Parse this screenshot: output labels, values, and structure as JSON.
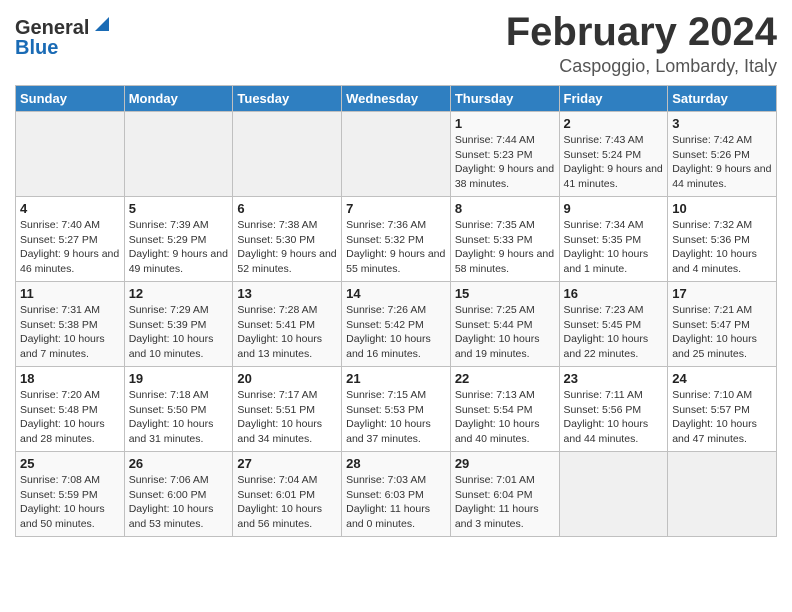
{
  "logo": {
    "text_general": "General",
    "text_blue": "Blue"
  },
  "title": "February 2024",
  "location": "Caspoggio, Lombardy, Italy",
  "weekdays": [
    "Sunday",
    "Monday",
    "Tuesday",
    "Wednesday",
    "Thursday",
    "Friday",
    "Saturday"
  ],
  "weeks": [
    [
      {
        "day": "",
        "sunrise": "",
        "sunset": "",
        "daylight": ""
      },
      {
        "day": "",
        "sunrise": "",
        "sunset": "",
        "daylight": ""
      },
      {
        "day": "",
        "sunrise": "",
        "sunset": "",
        "daylight": ""
      },
      {
        "day": "",
        "sunrise": "",
        "sunset": "",
        "daylight": ""
      },
      {
        "day": "1",
        "sunrise": "Sunrise: 7:44 AM",
        "sunset": "Sunset: 5:23 PM",
        "daylight": "Daylight: 9 hours and 38 minutes."
      },
      {
        "day": "2",
        "sunrise": "Sunrise: 7:43 AM",
        "sunset": "Sunset: 5:24 PM",
        "daylight": "Daylight: 9 hours and 41 minutes."
      },
      {
        "day": "3",
        "sunrise": "Sunrise: 7:42 AM",
        "sunset": "Sunset: 5:26 PM",
        "daylight": "Daylight: 9 hours and 44 minutes."
      }
    ],
    [
      {
        "day": "4",
        "sunrise": "Sunrise: 7:40 AM",
        "sunset": "Sunset: 5:27 PM",
        "daylight": "Daylight: 9 hours and 46 minutes."
      },
      {
        "day": "5",
        "sunrise": "Sunrise: 7:39 AM",
        "sunset": "Sunset: 5:29 PM",
        "daylight": "Daylight: 9 hours and 49 minutes."
      },
      {
        "day": "6",
        "sunrise": "Sunrise: 7:38 AM",
        "sunset": "Sunset: 5:30 PM",
        "daylight": "Daylight: 9 hours and 52 minutes."
      },
      {
        "day": "7",
        "sunrise": "Sunrise: 7:36 AM",
        "sunset": "Sunset: 5:32 PM",
        "daylight": "Daylight: 9 hours and 55 minutes."
      },
      {
        "day": "8",
        "sunrise": "Sunrise: 7:35 AM",
        "sunset": "Sunset: 5:33 PM",
        "daylight": "Daylight: 9 hours and 58 minutes."
      },
      {
        "day": "9",
        "sunrise": "Sunrise: 7:34 AM",
        "sunset": "Sunset: 5:35 PM",
        "daylight": "Daylight: 10 hours and 1 minute."
      },
      {
        "day": "10",
        "sunrise": "Sunrise: 7:32 AM",
        "sunset": "Sunset: 5:36 PM",
        "daylight": "Daylight: 10 hours and 4 minutes."
      }
    ],
    [
      {
        "day": "11",
        "sunrise": "Sunrise: 7:31 AM",
        "sunset": "Sunset: 5:38 PM",
        "daylight": "Daylight: 10 hours and 7 minutes."
      },
      {
        "day": "12",
        "sunrise": "Sunrise: 7:29 AM",
        "sunset": "Sunset: 5:39 PM",
        "daylight": "Daylight: 10 hours and 10 minutes."
      },
      {
        "day": "13",
        "sunrise": "Sunrise: 7:28 AM",
        "sunset": "Sunset: 5:41 PM",
        "daylight": "Daylight: 10 hours and 13 minutes."
      },
      {
        "day": "14",
        "sunrise": "Sunrise: 7:26 AM",
        "sunset": "Sunset: 5:42 PM",
        "daylight": "Daylight: 10 hours and 16 minutes."
      },
      {
        "day": "15",
        "sunrise": "Sunrise: 7:25 AM",
        "sunset": "Sunset: 5:44 PM",
        "daylight": "Daylight: 10 hours and 19 minutes."
      },
      {
        "day": "16",
        "sunrise": "Sunrise: 7:23 AM",
        "sunset": "Sunset: 5:45 PM",
        "daylight": "Daylight: 10 hours and 22 minutes."
      },
      {
        "day": "17",
        "sunrise": "Sunrise: 7:21 AM",
        "sunset": "Sunset: 5:47 PM",
        "daylight": "Daylight: 10 hours and 25 minutes."
      }
    ],
    [
      {
        "day": "18",
        "sunrise": "Sunrise: 7:20 AM",
        "sunset": "Sunset: 5:48 PM",
        "daylight": "Daylight: 10 hours and 28 minutes."
      },
      {
        "day": "19",
        "sunrise": "Sunrise: 7:18 AM",
        "sunset": "Sunset: 5:50 PM",
        "daylight": "Daylight: 10 hours and 31 minutes."
      },
      {
        "day": "20",
        "sunrise": "Sunrise: 7:17 AM",
        "sunset": "Sunset: 5:51 PM",
        "daylight": "Daylight: 10 hours and 34 minutes."
      },
      {
        "day": "21",
        "sunrise": "Sunrise: 7:15 AM",
        "sunset": "Sunset: 5:53 PM",
        "daylight": "Daylight: 10 hours and 37 minutes."
      },
      {
        "day": "22",
        "sunrise": "Sunrise: 7:13 AM",
        "sunset": "Sunset: 5:54 PM",
        "daylight": "Daylight: 10 hours and 40 minutes."
      },
      {
        "day": "23",
        "sunrise": "Sunrise: 7:11 AM",
        "sunset": "Sunset: 5:56 PM",
        "daylight": "Daylight: 10 hours and 44 minutes."
      },
      {
        "day": "24",
        "sunrise": "Sunrise: 7:10 AM",
        "sunset": "Sunset: 5:57 PM",
        "daylight": "Daylight: 10 hours and 47 minutes."
      }
    ],
    [
      {
        "day": "25",
        "sunrise": "Sunrise: 7:08 AM",
        "sunset": "Sunset: 5:59 PM",
        "daylight": "Daylight: 10 hours and 50 minutes."
      },
      {
        "day": "26",
        "sunrise": "Sunrise: 7:06 AM",
        "sunset": "Sunset: 6:00 PM",
        "daylight": "Daylight: 10 hours and 53 minutes."
      },
      {
        "day": "27",
        "sunrise": "Sunrise: 7:04 AM",
        "sunset": "Sunset: 6:01 PM",
        "daylight": "Daylight: 10 hours and 56 minutes."
      },
      {
        "day": "28",
        "sunrise": "Sunrise: 7:03 AM",
        "sunset": "Sunset: 6:03 PM",
        "daylight": "Daylight: 11 hours and 0 minutes."
      },
      {
        "day": "29",
        "sunrise": "Sunrise: 7:01 AM",
        "sunset": "Sunset: 6:04 PM",
        "daylight": "Daylight: 11 hours and 3 minutes."
      },
      {
        "day": "",
        "sunrise": "",
        "sunset": "",
        "daylight": ""
      },
      {
        "day": "",
        "sunrise": "",
        "sunset": "",
        "daylight": ""
      }
    ]
  ]
}
